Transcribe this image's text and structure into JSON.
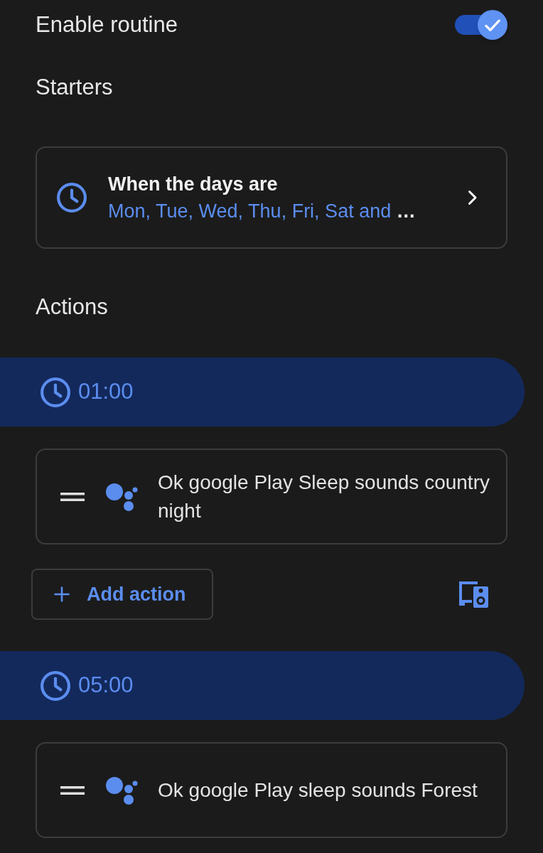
{
  "enable_routine": {
    "label": "Enable routine",
    "on": true
  },
  "starters": {
    "heading": "Starters",
    "items": [
      {
        "title": "When the days are",
        "subtitle": "Mon, Tue, Wed, Thu, Fri, Sat and",
        "overflow": "…"
      }
    ]
  },
  "actions": {
    "heading": "Actions",
    "groups": [
      {
        "time": "01:00",
        "items": [
          {
            "text": "Ok google Play Sleep sounds country night"
          }
        ],
        "add_button": {
          "label": "Add action"
        }
      },
      {
        "time": "05:00",
        "items": [
          {
            "text": "Ok google Play sleep sounds Forest"
          }
        ]
      }
    ]
  }
}
